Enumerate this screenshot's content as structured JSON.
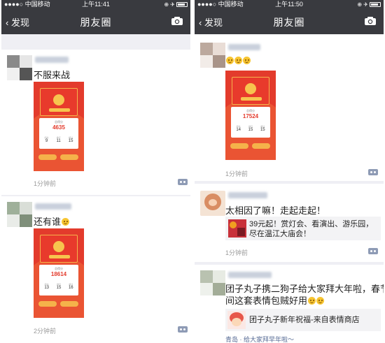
{
  "left": {
    "status": {
      "carrier": "●●●●○ 中国移动",
      "time": "上午11:41",
      "battery": "⊕ ✈"
    },
    "nav": {
      "back_label": "发现",
      "title": "朋友圈"
    },
    "posts": [
      {
        "text": "不服来战",
        "time": "1分钟前",
        "card": {
          "label": "总得分",
          "score": "4635",
          "stats": [
            {
              "label": "闯关",
              "value": "9"
            },
            {
              "label": "排行",
              "value": "11"
            },
            {
              "label": "超过",
              "value": "15"
            }
          ]
        }
      },
      {
        "text": "还有谁",
        "time": "2分钟前",
        "card": {
          "label": "总得分",
          "score": "18614",
          "stats": [
            {
              "label": "闯关",
              "value": "13"
            },
            {
              "label": "排行",
              "value": "15"
            },
            {
              "label": "超过",
              "value": "16"
            }
          ]
        }
      }
    ]
  },
  "right": {
    "status": {
      "carrier": "●●●●○ 中国移动",
      "time": "上午11:50",
      "battery": "⊕ ✈"
    },
    "nav": {
      "back_label": "发现",
      "title": "朋友圈"
    },
    "posts": [
      {
        "time": "1分钟前",
        "card": {
          "label": "总得分",
          "score": "17524",
          "stats": [
            {
              "label": "闯关",
              "value": "14"
            },
            {
              "label": "排行",
              "value": "15"
            },
            {
              "label": "超过",
              "value": "15"
            }
          ]
        }
      },
      {
        "text": "太相因了嘛！走起走起！",
        "link_line1": "39元起！赏灯会、看演出、游乐园，",
        "link_line2": "尽在温江大庙会！",
        "time": "1分钟前"
      },
      {
        "text_line1": "团子丸子携二狗子给大家拜大年啦，春节期",
        "text_line2": "间这套表情包贼好用",
        "link_text": "团子丸子新年祝福-来自表情商店",
        "location": "青岛 · 给大家拜早年啦～"
      }
    ]
  }
}
